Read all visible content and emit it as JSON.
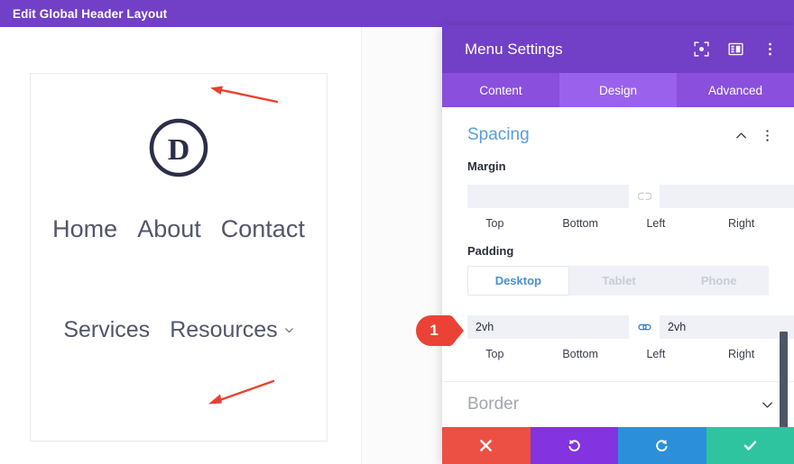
{
  "topbar": {
    "title": "Edit Global Header Layout"
  },
  "preview": {
    "logo_letter": "D",
    "logo_icon": "divi-logo-icon",
    "menu_row_1": [
      {
        "label": "Home",
        "has_submenu": false
      },
      {
        "label": "About",
        "has_submenu": false
      },
      {
        "label": "Contact",
        "has_submenu": false
      }
    ],
    "menu_row_2": [
      {
        "label": "Services",
        "has_submenu": false
      },
      {
        "label": "Resources",
        "has_submenu": true
      }
    ],
    "annotations": [
      {
        "name": "arrow-pointing-to-top-padding",
        "color": "#e8412f"
      },
      {
        "name": "arrow-pointing-to-bottom-padding",
        "color": "#e8412f"
      }
    ]
  },
  "modal": {
    "title": "Menu Settings",
    "header_icons": [
      "focus-target-icon",
      "layout-panel-icon",
      "kebab-menu-icon"
    ],
    "tabs": [
      {
        "label": "Content",
        "active": false
      },
      {
        "label": "Design",
        "active": true
      },
      {
        "label": "Advanced",
        "active": false
      }
    ],
    "sections": {
      "spacing": {
        "title": "Spacing",
        "expanded": true,
        "collapse_icon": "chevron-up-icon",
        "options_icon": "kebab-menu-icon",
        "margin": {
          "label": "Margin",
          "fields": [
            {
              "side": "Top",
              "value": "",
              "placeholder": ""
            },
            {
              "side": "Bottom",
              "value": "",
              "placeholder": ""
            },
            {
              "side": "Left",
              "value": "",
              "placeholder": ""
            },
            {
              "side": "Right",
              "value": "",
              "placeholder": ""
            }
          ],
          "link_top_bottom": false,
          "link_left_right": false
        },
        "padding": {
          "label": "Padding",
          "responsive": [
            {
              "label": "Desktop",
              "active": true
            },
            {
              "label": "Tablet",
              "active": false
            },
            {
              "label": "Phone",
              "active": false
            }
          ],
          "fields": [
            {
              "side": "Top",
              "value": "2vh",
              "placeholder": ""
            },
            {
              "side": "Bottom",
              "value": "2vh",
              "placeholder": ""
            },
            {
              "side": "Left",
              "value": "",
              "placeholder": ""
            },
            {
              "side": "Right",
              "value": "",
              "placeholder": ""
            }
          ],
          "link_top_bottom": true,
          "link_left_right": false
        }
      },
      "border": {
        "title": "Border",
        "expanded": false,
        "expand_icon": "chevron-down-icon"
      }
    },
    "actions": [
      {
        "name": "cancel",
        "icon": "close-x-icon",
        "color": "#ec5044"
      },
      {
        "name": "undo",
        "icon": "undo-arrow-icon",
        "color": "#8333e0"
      },
      {
        "name": "redo",
        "icon": "redo-arrow-icon",
        "color": "#2b90d9"
      },
      {
        "name": "save",
        "icon": "check-icon",
        "color": "#2ec4a0"
      }
    ]
  },
  "step_badge": {
    "number": "1",
    "color": "#ea4335"
  },
  "colors": {
    "brand_purple": "#7140c7",
    "tab_purple": "#8a4fdd",
    "tab_active_purple": "#9a62ec",
    "section_blue": "#5b9dd9",
    "input_bg": "#eff1f6",
    "annotation_red": "#e8412f"
  }
}
